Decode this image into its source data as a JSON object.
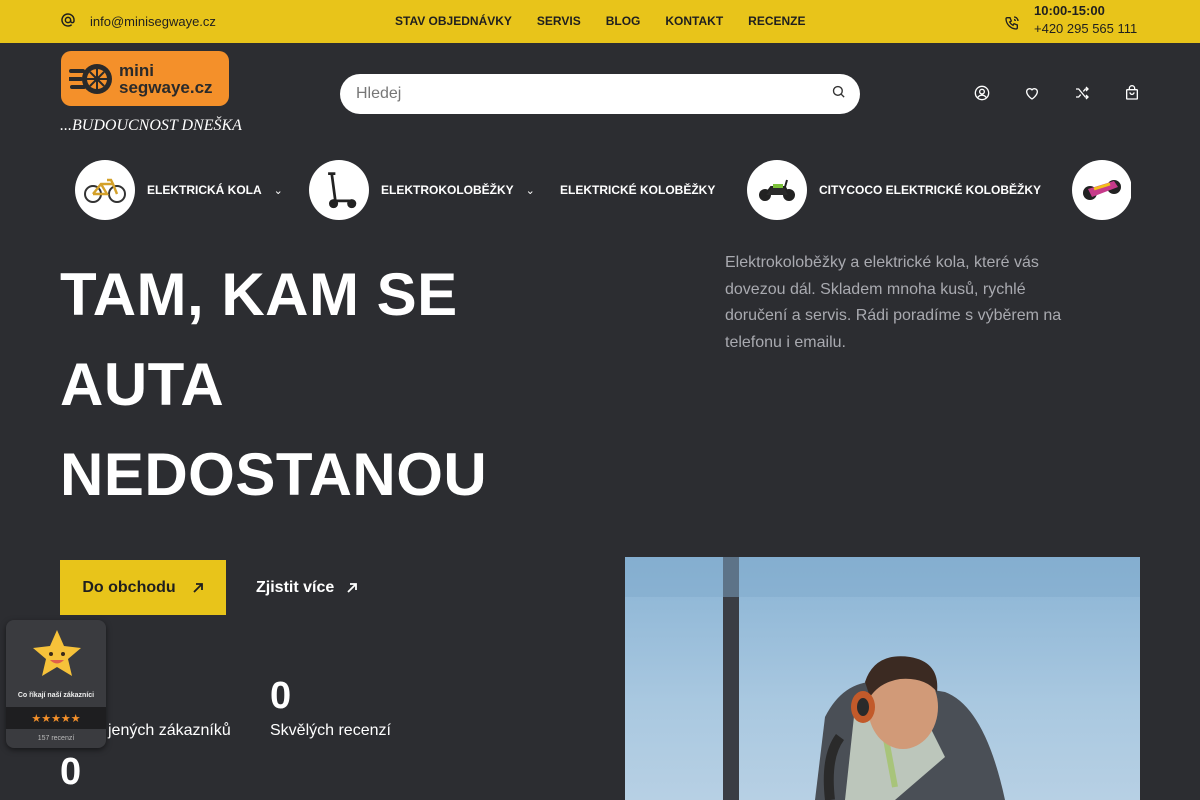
{
  "topbar": {
    "email": "info@minisegwaye.cz",
    "nav": [
      "STAV OBJEDNÁVKY",
      "SERVIS",
      "BLOG",
      "KONTAKT",
      "RECENZE"
    ],
    "hours": "10:00-15:00",
    "phone": "+420 295 565 111"
  },
  "header": {
    "logo_line1": "mini",
    "logo_line2": "segwaye.cz",
    "tagline": "...BUDOUCNOST DNEŠKA",
    "search_placeholder": "Hledej",
    "icons": [
      "user-icon",
      "heart-icon",
      "shuffle-icon",
      "bag-icon"
    ]
  },
  "categories": [
    {
      "label": "ELEKTRICKÁ KOLA",
      "icon": "bicycle-icon"
    },
    {
      "label": "ELEKTROKOLOBĚŽKY",
      "icon": "scooter-icon"
    },
    {
      "label": "ELEKTRICKÉ KOLOBĚŽKY",
      "icon": ""
    },
    {
      "label": "CITYCOCO ELEKTRICKÉ KOLOBĚŽKY",
      "icon": "citycoco-icon"
    },
    {
      "label": "",
      "icon": "hoverboard-icon"
    }
  ],
  "hero": {
    "title_line1": "TAM, KAM SE",
    "title_line2": "AUTA",
    "title_line3": "NEDOSTANOU",
    "description": "Elektrokoloběžky a elektrické kola, které vás dovezou dál. Skladem mnoha kusů, rychlé doručení a servis. Rádi poradíme s výběrem na telefonu i emailu.",
    "btn_shop": "Do obchodu",
    "btn_more": "Zjistit více"
  },
  "stats": [
    {
      "num": "0",
      "label": "jených zákazníků"
    },
    {
      "num": "0",
      "label": "Skvělých recenzí"
    },
    {
      "num": "0",
      "label": ""
    }
  ],
  "review_widget": {
    "text": "Co říkají naší zákazníci",
    "stars": "★★★★★",
    "count": "157 recenzí"
  },
  "colors": {
    "accent": "#e8c41a",
    "background": "#2c2d31",
    "logo": "#f4902a"
  }
}
